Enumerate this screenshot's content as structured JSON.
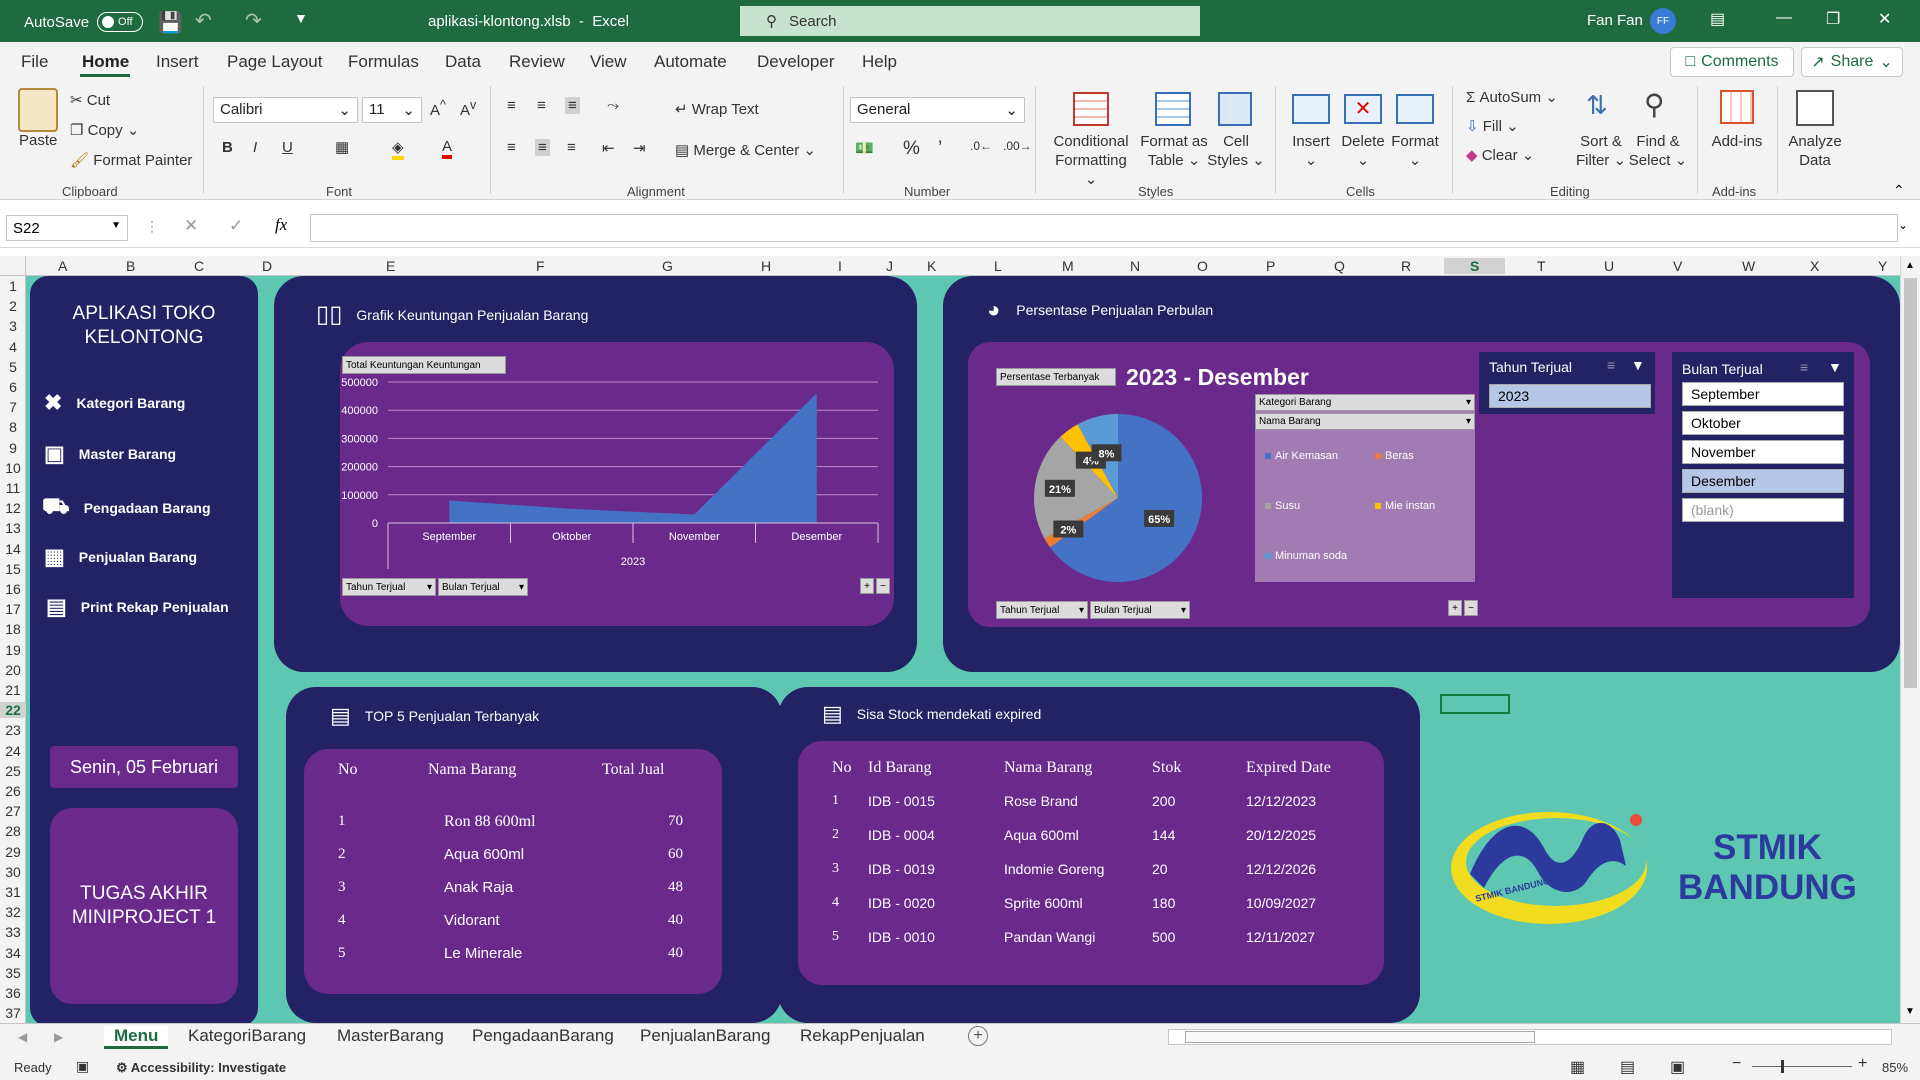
{
  "titlebar": {
    "autosave_label": "AutoSave",
    "autosave_state": "Off",
    "filename": "aplikasi-klontong.xlsb",
    "app": "Excel",
    "search_placeholder": "Search",
    "user_name": "Fan Fan",
    "user_initials": "FF"
  },
  "menu": {
    "tabs": [
      "File",
      "Home",
      "Insert",
      "Page Layout",
      "Formulas",
      "Data",
      "Review",
      "View",
      "Automate",
      "Developer",
      "Help"
    ],
    "comments": "Comments",
    "share": "Share"
  },
  "ribbon": {
    "clipboard": {
      "paste": "Paste",
      "cut": "Cut",
      "copy": "Copy",
      "format_painter": "Format Painter",
      "group": "Clipboard"
    },
    "font": {
      "name": "Calibri",
      "size": "11",
      "group": "Font"
    },
    "alignment": {
      "wrap": "Wrap Text",
      "merge": "Merge & Center",
      "group": "Alignment"
    },
    "number": {
      "format": "General",
      "group": "Number"
    },
    "styles": {
      "conditional": "Conditional",
      "conditional2": "Formatting",
      "format_as": "Format as",
      "format_as2": "Table",
      "cell": "Cell",
      "cell2": "Styles",
      "group": "Styles"
    },
    "cells": {
      "insert": "Insert",
      "delete": "Delete",
      "format": "Format",
      "group": "Cells"
    },
    "editing": {
      "autosum": "AutoSum",
      "fill": "Fill",
      "clear": "Clear",
      "sort": "Sort &",
      "sort2": "Filter",
      "find": "Find &",
      "find2": "Select",
      "group": "Editing"
    },
    "addins": {
      "label": "Add-ins",
      "group": "Add-ins"
    },
    "analyze": {
      "label": "Analyze",
      "label2": "Data"
    }
  },
  "formula": {
    "cell_ref": "S22",
    "fx": "fx",
    "value": ""
  },
  "columns": [
    "A",
    "B",
    "C",
    "D",
    "E",
    "F",
    "G",
    "H",
    "I",
    "J",
    "K",
    "L",
    "M",
    "N",
    "O",
    "P",
    "Q",
    "R",
    "S",
    "T",
    "U",
    "V",
    "W",
    "X",
    "Y"
  ],
  "rows": [
    "1",
    "2",
    "3",
    "4",
    "5",
    "6",
    "7",
    "8",
    "9",
    "10",
    "11",
    "12",
    "13",
    "14",
    "15",
    "16",
    "17",
    "18",
    "19",
    "20",
    "21",
    "22",
    "23",
    "24",
    "25",
    "26",
    "27",
    "28",
    "29",
    "30",
    "31",
    "32",
    "33",
    "34",
    "35",
    "36",
    "37"
  ],
  "sidebar": {
    "title_line1": "APLIKASI TOKO",
    "title_line2": "KELONTONG",
    "items": [
      "Kategori Barang",
      "Master Barang",
      "Pengadaan Barang",
      "Penjualan Barang",
      "Print Rekap Penjualan"
    ],
    "date": "Senin, 05 Februari",
    "project_line1": "TUGAS AKHIR",
    "project_line2": "MINIPROJECT 1"
  },
  "area_chart": {
    "header": "Grafik Keuntungan Penjualan Barang",
    "field_button": "Total Keuntungan Keuntungan",
    "filter1": "Tahun Terjual",
    "filter2": "Bulan Terjual",
    "series_color": "#4472c4"
  },
  "pie_panel": {
    "header": "Persentase Penjualan Perbulan",
    "field_button": "Persentase Terbanyak",
    "title": "2023 - Desember",
    "filter1": "Tahun Terjual",
    "filter2": "Bulan Terjual",
    "dropdown1": "Kategori Barang",
    "dropdown2": "Nama Barang"
  },
  "chart_data": [
    {
      "type": "area",
      "categories": [
        "September",
        "Oktober",
        "November",
        "Desember"
      ],
      "group_label": "2023",
      "series": [
        {
          "values": [
            80000,
            50000,
            30000,
            460000
          ]
        }
      ],
      "yticks": [
        "500000",
        "400000",
        "300000",
        "200000",
        "100000",
        "0"
      ],
      "ylim": [
        0,
        500000
      ],
      "grid": true
    },
    {
      "type": "pie",
      "categories": [
        "Air Kemasan",
        "Beras",
        "Susu",
        "Mie instan",
        "Minuman soda"
      ],
      "values": [
        65,
        2,
        21,
        4,
        8
      ],
      "labels": [
        "65%",
        "2%",
        "21%",
        "4%",
        "8%"
      ],
      "colors": [
        "#4472c4",
        "#ed7d31",
        "#a5a5a5",
        "#ffc000",
        "#5b9bd5"
      ]
    }
  ],
  "slicer_tahun": {
    "title": "Tahun Terjual",
    "items": [
      "2023"
    ]
  },
  "slicer_bulan": {
    "title": "Bulan Terjual",
    "items": [
      "September",
      "Oktober",
      "November",
      "Desember",
      "(blank)"
    ]
  },
  "top5": {
    "header": "TOP 5 Penjualan Terbanyak",
    "columns": [
      "No",
      "Nama Barang",
      "Total Jual"
    ],
    "rows": [
      [
        "1",
        "Ron 88 600ml",
        "70"
      ],
      [
        "2",
        "Aqua 600ml",
        "60"
      ],
      [
        "3",
        "Anak Raja",
        "48"
      ],
      [
        "4",
        "Vidorant",
        "40"
      ],
      [
        "5",
        "Le Minerale",
        "40"
      ]
    ]
  },
  "stock": {
    "header": "Sisa Stock mendekati expired",
    "columns": [
      "No",
      "Id Barang",
      "Nama Barang",
      "Stok",
      "Expired Date"
    ],
    "rows": [
      [
        "1",
        "IDB - 0015",
        "Rose Brand",
        "200",
        "12/12/2023"
      ],
      [
        "2",
        "IDB - 0004",
        "Aqua 600ml",
        "144",
        "20/12/2025"
      ],
      [
        "3",
        "IDB - 0019",
        "Indomie Goreng",
        "20",
        "12/12/2026"
      ],
      [
        "4",
        "IDB - 0020",
        "Sprite 600ml",
        "180",
        "10/09/2027"
      ],
      [
        "5",
        "IDB - 0010",
        "Pandan Wangi",
        "500",
        "12/11/2027"
      ]
    ]
  },
  "logo": {
    "line1": "STMIK",
    "line2": "BANDUNG",
    "ring_text": "STMIK BANDUNG 1993"
  },
  "sheets": [
    "Menu",
    "KategoriBarang",
    "MasterBarang",
    "PengadaanBarang",
    "PenjualanBarang",
    "RekapPenjualan"
  ],
  "status": {
    "ready": "Ready",
    "accessibility": "Accessibility: Investigate",
    "zoom": "85%"
  }
}
